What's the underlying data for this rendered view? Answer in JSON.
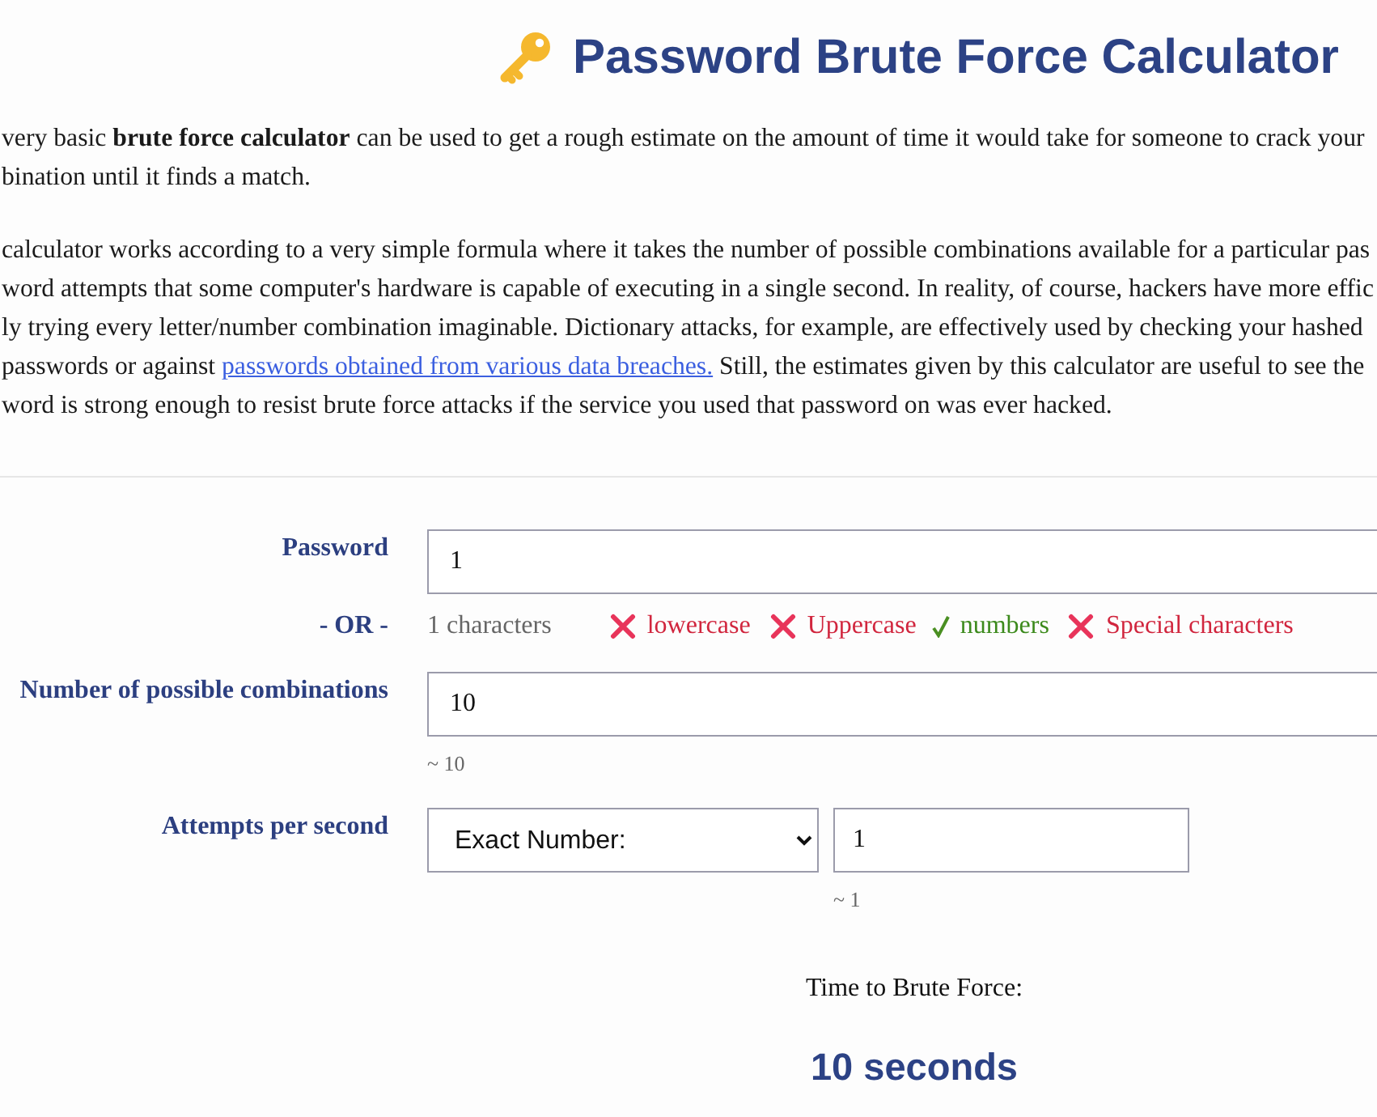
{
  "header": {
    "title": "Password Brute Force Calculator"
  },
  "intro": {
    "paragraphs": [
      {
        "lines": [
          {
            "text": "very basic **brute force calculator** can be used to get a rough estimate on the amount of time it would take for someone to crack your"
          },
          {
            "text": "bination until it finds a match."
          }
        ]
      },
      {
        "lines": [
          {
            "text": "calculator works according to a very simple formula where it takes the number of possible combinations available for a particular pas"
          },
          {
            "text": "word attempts that some computer's hardware is capable of executing in a single second. In reality, of course, hackers have more effic"
          },
          {
            "text": "ly trying every letter/number combination imaginable. Dictionary attacks, for example, are effectively used by checking your hashed"
          },
          {
            "text": "passwords or against ",
            "link": "passwords obtained from various data breaches.",
            "after": " Still, the estimates given by this calculator are useful to see the"
          },
          {
            "text": "word is strong enough to resist brute force attacks if the service you used that password on was ever hacked."
          }
        ]
      }
    ]
  },
  "form": {
    "password": {
      "label": "Password",
      "value": "1"
    },
    "analysis": {
      "label": "- OR -",
      "count": "1 characters",
      "checks": [
        {
          "label": "lowercase",
          "checked": false
        },
        {
          "label": "Uppercase",
          "checked": false
        },
        {
          "label": "numbers",
          "checked": true
        },
        {
          "label": "Special characters",
          "checked": false
        }
      ]
    },
    "combinations": {
      "label": "Number of possible combinations",
      "value": "10",
      "approx": "~ 10"
    },
    "attempts": {
      "label": "Attempts per second",
      "mode": "Exact Number:",
      "value": "1",
      "approx": "~ 1"
    }
  },
  "result": {
    "label": "Time to Brute Force:",
    "value": "10 seconds"
  }
}
